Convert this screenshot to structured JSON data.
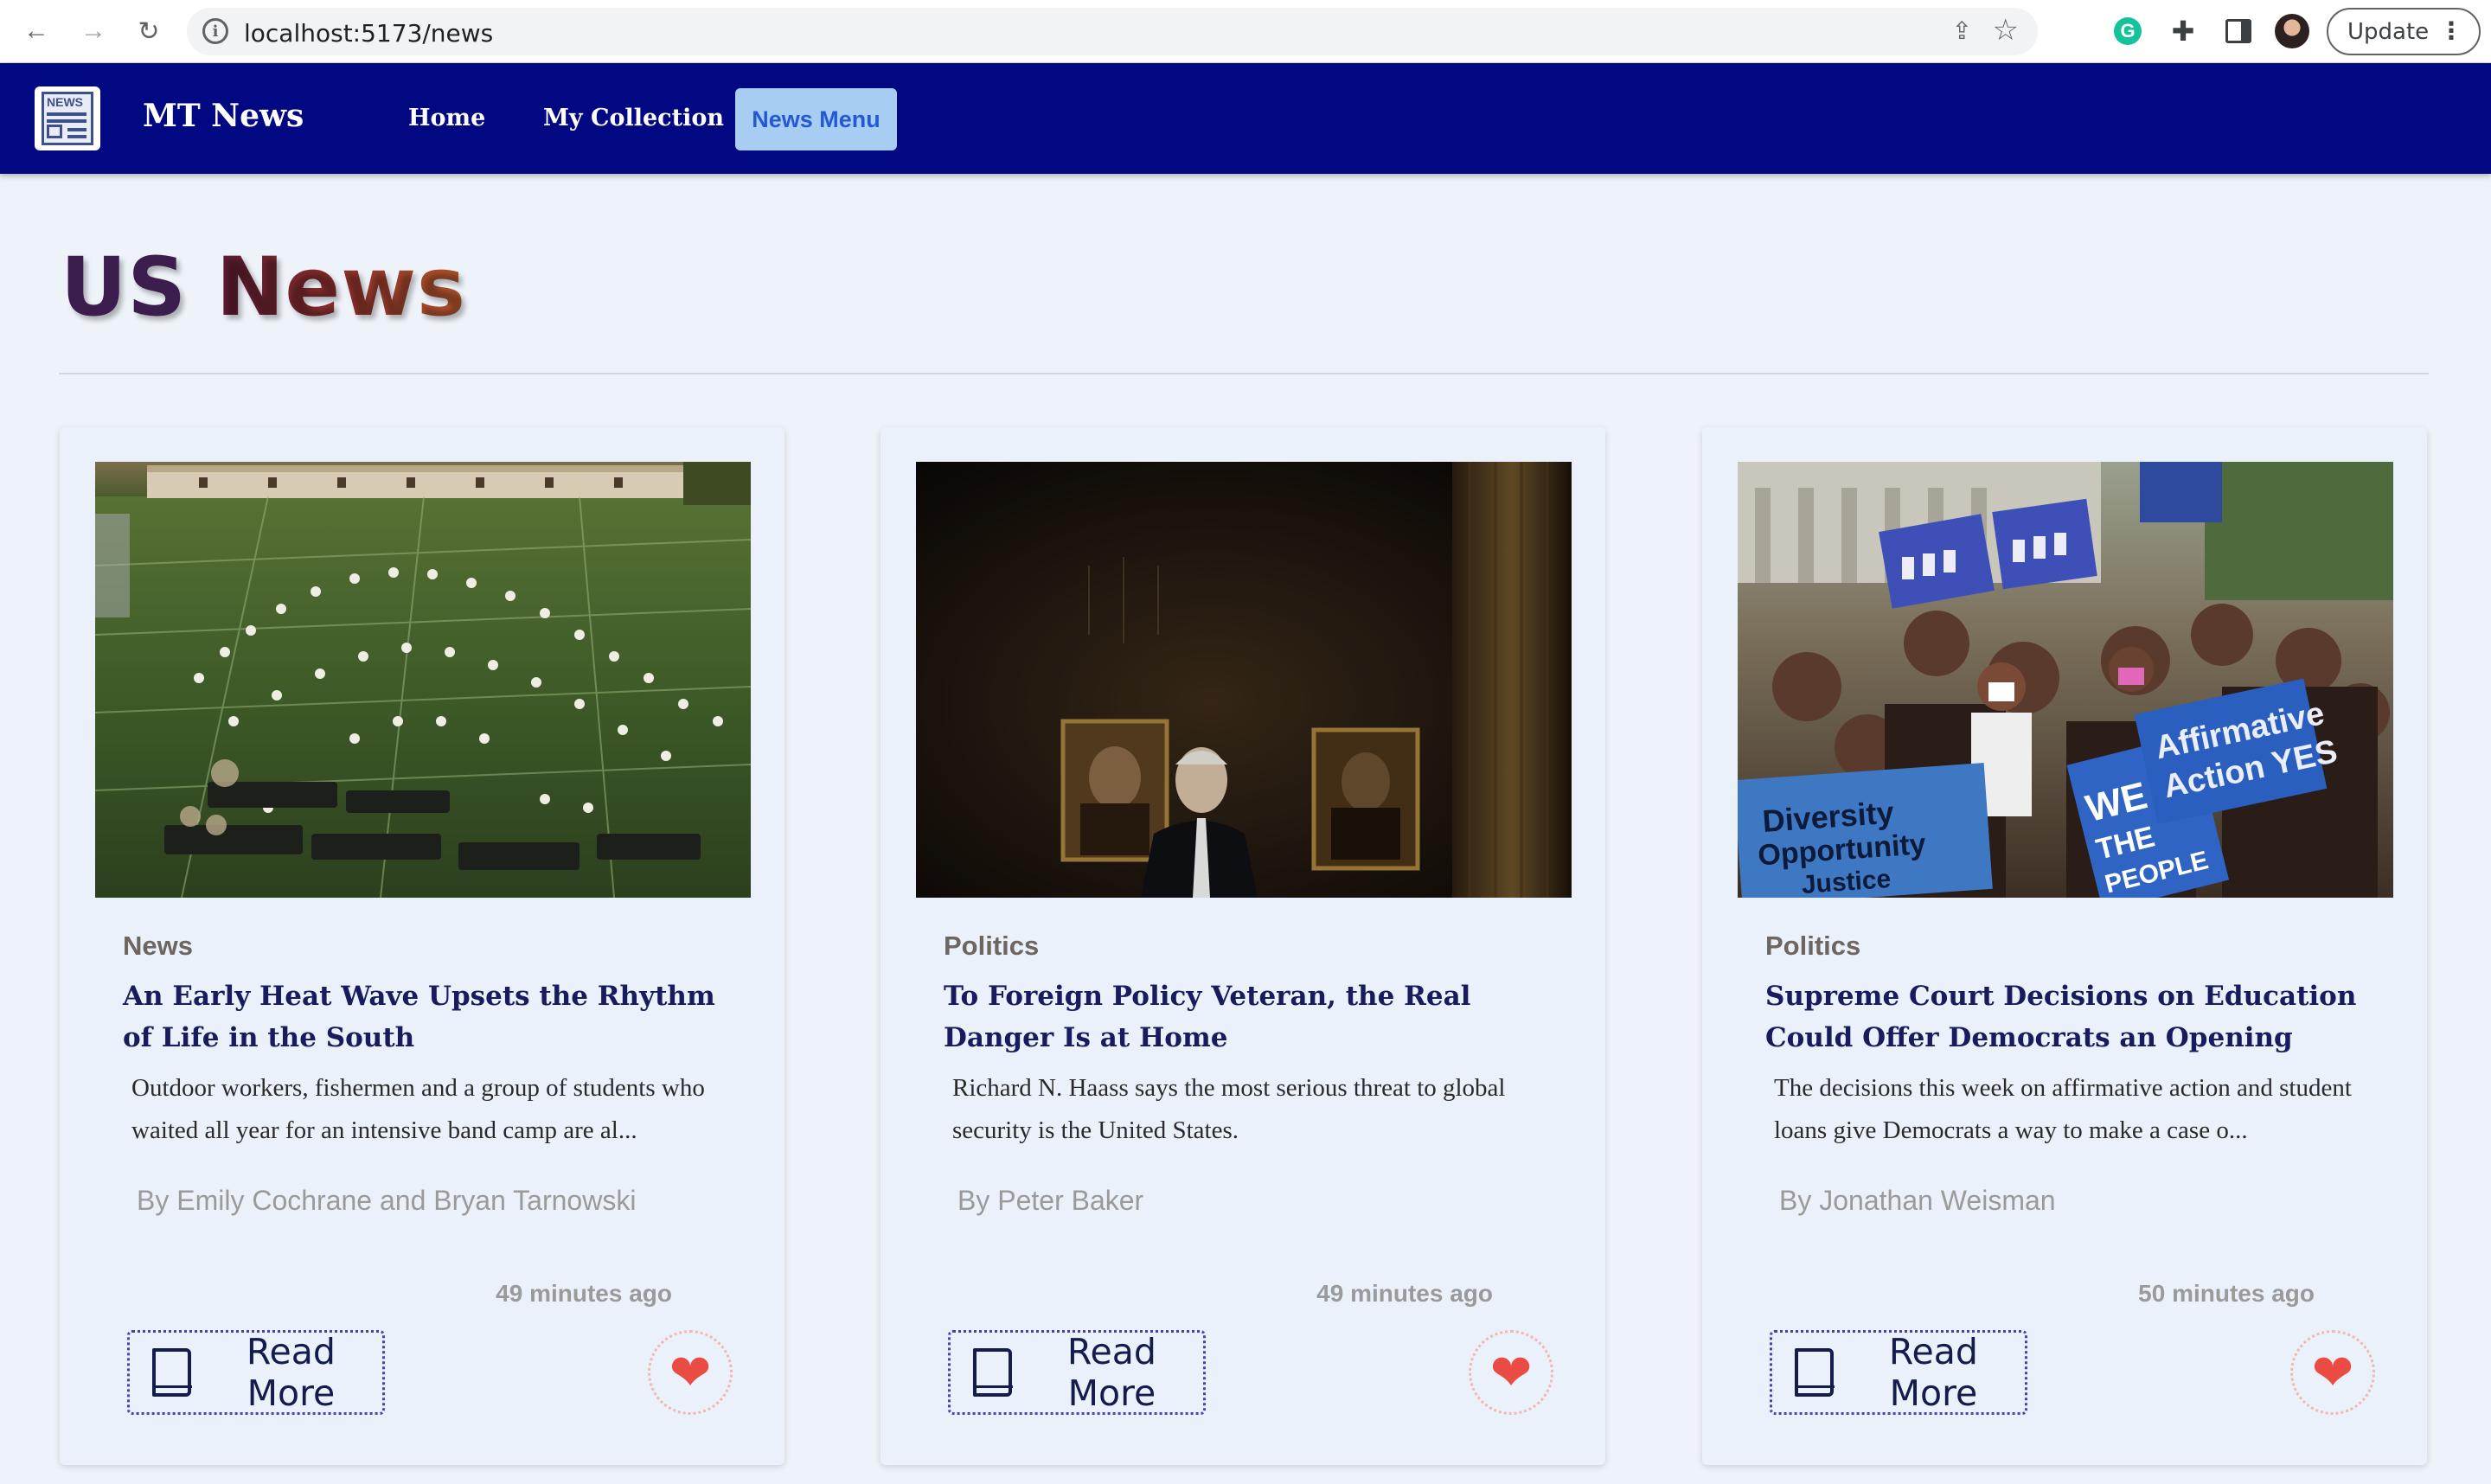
{
  "browser": {
    "url": "localhost:5173/news",
    "update_label": "Update",
    "back_icon": "←",
    "forward_icon": "→",
    "reload_icon": "↻",
    "share_icon": "⇪",
    "star_icon": "☆",
    "grammarly_letter": "G",
    "puzzle_icon": "✚",
    "menu_dots": "⋮"
  },
  "app": {
    "logo_text": "NEWS",
    "brand": "MT News",
    "nav": {
      "home": "Home",
      "collection": "My Collection",
      "menu": "News Menu"
    }
  },
  "page": {
    "title_part1": "US ",
    "title_part2": "News"
  },
  "articles": [
    {
      "category": "News",
      "headline": "An Early Heat Wave Upsets the Rhythm of Life in the South",
      "summary": "Outdoor workers, fishermen and a group of students who waited all year for an intensive band camp are al...",
      "byline": "By Emily Cochrane and Bryan Tarnowski",
      "time": "49 minutes ago",
      "read_more": "Read More",
      "heart": "❤"
    },
    {
      "category": "Politics",
      "headline": "To Foreign Policy Veteran, the Real Danger Is at Home",
      "summary": "Richard N. Haass says the most serious threat to global security is the United States.",
      "byline": "By Peter Baker",
      "time": "49 minutes ago",
      "read_more": "Read More",
      "heart": "❤"
    },
    {
      "category": "Politics",
      "headline": "Supreme Court Decisions on Education Could Offer Democrats an Opening",
      "summary": "The decisions this week on affirmative action and student loans give Democrats a way to make a case o...",
      "byline": "By Jonathan Weisman",
      "time": "50 minutes ago",
      "read_more": "Read More",
      "heart": "❤",
      "photo_signs": [
        "Diversity Opportunity Justice",
        "WE THE PEOPLE",
        "Affirmative Action YES"
      ]
    }
  ]
}
